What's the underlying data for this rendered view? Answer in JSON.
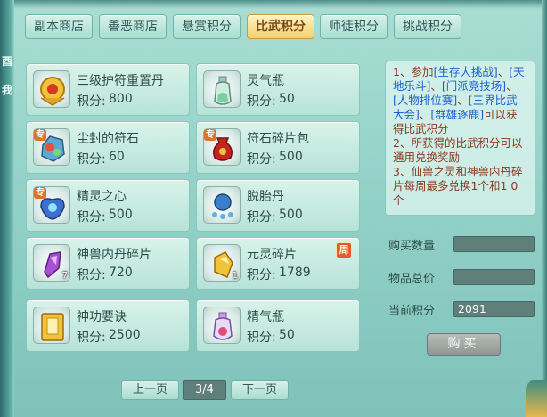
{
  "tabs": [
    {
      "label": "副本商店"
    },
    {
      "label": "善恶商店"
    },
    {
      "label": "悬赏积分"
    },
    {
      "label": "比武积分"
    },
    {
      "label": "师徒积分"
    },
    {
      "label": "挑战积分"
    }
  ],
  "active_tab": "比武积分",
  "edge_glyphs": [
    "酉",
    "我"
  ],
  "price_label": "积分:",
  "items": [
    {
      "name": "三级护符重置丹",
      "price": "800",
      "icon": "gold-amulet-icon"
    },
    {
      "name": "灵气瓶",
      "price": "50",
      "icon": "spirit-bottle-icon"
    },
    {
      "name": "尘封的符石",
      "price": "60",
      "icon": "rune-stone-icon",
      "badge": "专"
    },
    {
      "name": "符石碎片包",
      "price": "500",
      "icon": "rune-shard-bag-icon",
      "badge": "专"
    },
    {
      "name": "精灵之心",
      "price": "500",
      "icon": "spirit-heart-icon",
      "badge": "专"
    },
    {
      "name": "脱胎丹",
      "price": "500",
      "icon": "rebirth-pill-icon"
    },
    {
      "name": "神兽内丹碎片",
      "price": "720",
      "icon": "beast-core-shard-icon",
      "count": "7"
    },
    {
      "name": "元灵碎片",
      "price": "1789",
      "icon": "yuanling-shard-icon",
      "count": "1",
      "week_badge": "周"
    },
    {
      "name": "神功要诀",
      "price": "2500",
      "icon": "skill-book-icon"
    },
    {
      "name": "精气瓶",
      "price": "50",
      "icon": "essence-bottle-icon"
    }
  ],
  "info": {
    "p1_a": "1、参加",
    "p1_link1": "[生存大挑战]",
    "p1_sep1": "、",
    "p1_link2": "[天地乐斗]",
    "p1_sep2": "、",
    "p1_link3": "[门派竞技场]",
    "p1_sep3": "、",
    "p1_link4": "[人物排位赛]",
    "p1_sep4": "、",
    "p1_link5": "[三界比武大会]",
    "p1_sep5": "、",
    "p1_link6": "[群雄逐鹿]",
    "p1_b": "可以获得比武积分",
    "p2": "2、所获得的比武积分可以通用兑换奖励",
    "p3": "3、仙兽之灵和神兽内丹碎片每周最多兑换1个和1 0个"
  },
  "purchase": {
    "qty_label": "购买数量",
    "qty_value": "",
    "total_label": "物品总价",
    "total_value": "",
    "current_label": "当前积分",
    "current_value": "2091",
    "buy_label": "购买"
  },
  "pager": {
    "prev": "上一页",
    "page": "3/4",
    "next": "下一页"
  },
  "colors": {
    "panel_bg": "#a9ddd3",
    "active_tab": "#f6cf6b",
    "info_text": "#8a3b1f",
    "info_link": "#1e5fd1"
  }
}
